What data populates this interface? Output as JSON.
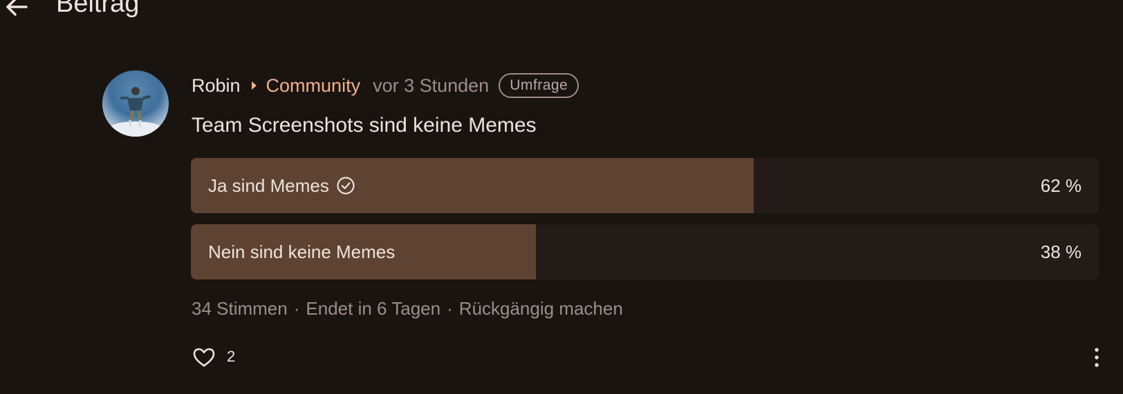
{
  "header": {
    "title": "Beitrag",
    "back_icon": "arrow-left-icon"
  },
  "post": {
    "author": "Robin",
    "community": "Community",
    "time": "vor 3 Stunden",
    "badge": "Umfrage",
    "title": "Team Screenshots sind keine Memes",
    "avatar_icon": "avatar-image"
  },
  "poll": {
    "options": [
      {
        "label": "Ja sind Memes",
        "percent_label": "62 %",
        "fraction": 0.62,
        "selected": true
      },
      {
        "label": "Nein sind keine Memes",
        "percent_label": "38 %",
        "fraction": 0.38,
        "selected": false
      }
    ],
    "votes": "34 Stimmen",
    "ends": "Endet in 6 Tagen",
    "undo": "Rückgängig machen",
    "separator": "·"
  },
  "actions": {
    "likes": "2",
    "like_icon": "heart-icon",
    "more_icon": "more-vertical-icon"
  },
  "colors": {
    "background": "#1a1411",
    "accent": "#f0b08a",
    "bar_fill": "#5e4232",
    "bar_track": "#231b17",
    "muted_text": "#9a8f88"
  }
}
